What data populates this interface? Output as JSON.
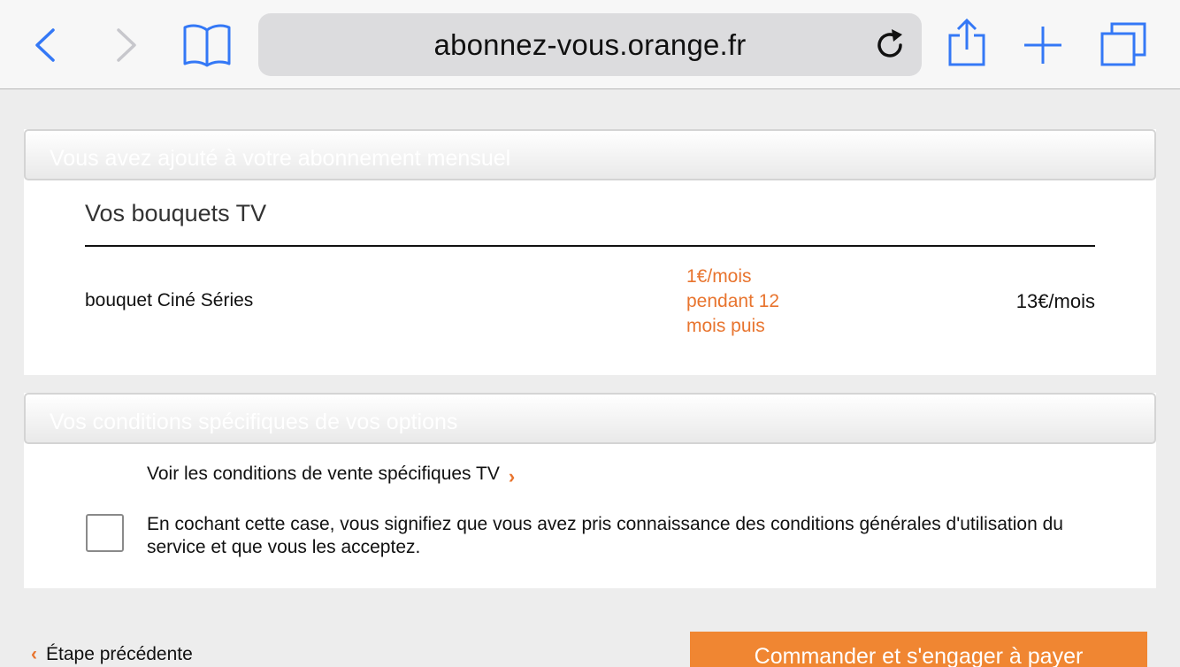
{
  "browser": {
    "url": "abonnez-vous.orange.fr",
    "icons": {
      "back": "chevron-left-icon",
      "forward": "chevron-right-icon",
      "bookmarks": "book-icon",
      "reload": "reload-icon",
      "share": "share-icon",
      "new_tab": "plus-icon",
      "tabs": "tabs-icon"
    },
    "accent": "#3478f6"
  },
  "subscription": {
    "header": "Vous avez ajouté à votre abonnement mensuel",
    "section_title": "Vos bouquets TV",
    "item": {
      "name": "bouquet Ciné Séries",
      "promo_lines": [
        "1€/mois",
        "pendant 12",
        "mois puis"
      ],
      "price": "13€/mois"
    }
  },
  "conditions": {
    "header": "Vos conditions spécifiques de vos options",
    "link_label": "Voir les conditions de vente spécifiques TV",
    "link_chevron": "›",
    "accept_text": "En cochant cette case, vous signifiez que vous avez pris connaissance des conditions générales d'utilisation du service et que vous les acceptez.",
    "checked": false
  },
  "footer": {
    "back_chevron": "‹",
    "back_label": "Étape précédente",
    "order_button": "Commander et s'engager à payer"
  },
  "colors": {
    "orange": "#f08632",
    "promo_orange": "#e8742e"
  }
}
